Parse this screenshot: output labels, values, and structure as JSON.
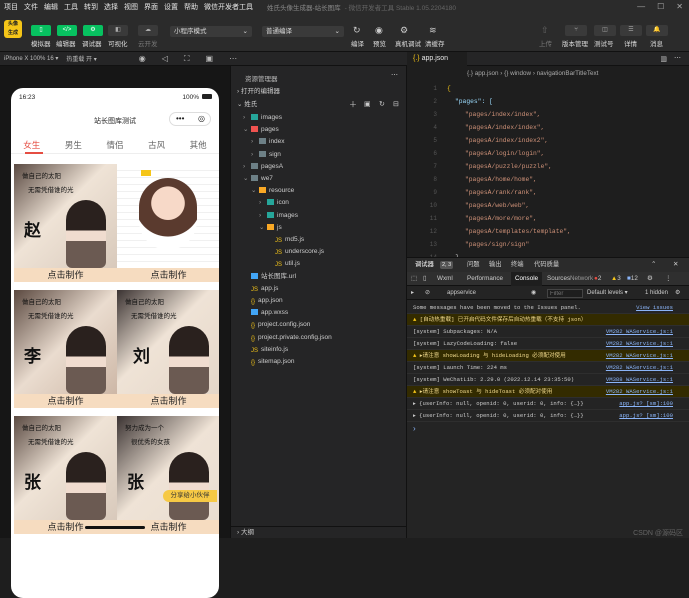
{
  "menu": [
    "项目",
    "文件",
    "编辑",
    "工具",
    "转到",
    "选择",
    "视图",
    "界面",
    "设置",
    "帮助",
    "微信开发者工具"
  ],
  "window_title": "姓氏头像生成器-站长图库",
  "window_subtitle": "- 微信开发者工具 Stable 1.05.2204180",
  "toolbar": {
    "left": [
      "模拟器",
      "编辑器",
      "调试器",
      "可视化",
      "云开发"
    ],
    "mode_select": "小程序模式",
    "compile_select": "普通编译",
    "mid": [
      "编译",
      "预览",
      "真机调试",
      "清缓存"
    ],
    "right": [
      "上传",
      "版本管理",
      "测试号",
      "详情",
      "消息"
    ]
  },
  "subbar": {
    "device": "iPhone X 100% 16 ▾",
    "hotreload": "热重载 开 ▾"
  },
  "phone": {
    "time": "16:23",
    "battery": "100%",
    "title": "站长图库测试",
    "tabs": [
      "女生",
      "男生",
      "情侣",
      "古风",
      "其他"
    ],
    "cards": [
      {
        "char": "赵",
        "line1": "做自己的太阳",
        "line2": "无需凭借谁的光",
        "caption": "点击制作"
      },
      {
        "char": "",
        "line1": "",
        "line2": "",
        "caption": "点击制作"
      },
      {
        "char": "李",
        "line1": "做自己的太阳",
        "line2": "无需凭借谁的光",
        "caption": "点击制作"
      },
      {
        "char": "刘",
        "line1": "做自己的太阳",
        "line2": "无需凭借谁的光",
        "caption": "点击制作"
      },
      {
        "char": "张",
        "line1": "做自己的太阳",
        "line2": "无需凭借谁的光",
        "caption": "点击制作"
      },
      {
        "char": "张",
        "line1": "努力成为一个",
        "line2": "很优秀的女孩",
        "caption": "点击制作"
      }
    ],
    "share": "分享给小伙伴"
  },
  "explorer": {
    "title": "资源管理器",
    "open_editors": "打开的编辑器",
    "project": "姓氏",
    "tree": [
      {
        "label": "images",
        "indent": 1,
        "kind": "folder-teal",
        "arrow": "›"
      },
      {
        "label": "pages",
        "indent": 1,
        "kind": "folder-red",
        "arrow": "⌄"
      },
      {
        "label": "index",
        "indent": 2,
        "kind": "folder",
        "arrow": "›"
      },
      {
        "label": "sign",
        "indent": 2,
        "kind": "folder",
        "arrow": "›"
      },
      {
        "label": "pagesA",
        "indent": 1,
        "kind": "folder",
        "arrow": "›"
      },
      {
        "label": "we7",
        "indent": 1,
        "kind": "folder",
        "arrow": "⌄"
      },
      {
        "label": "resource",
        "indent": 2,
        "kind": "folder-yellow",
        "arrow": "⌄"
      },
      {
        "label": "icon",
        "indent": 3,
        "kind": "folder-teal",
        "arrow": "›"
      },
      {
        "label": "images",
        "indent": 3,
        "kind": "folder-teal",
        "arrow": "›"
      },
      {
        "label": "js",
        "indent": 3,
        "kind": "folder-yellow",
        "arrow": "⌄"
      },
      {
        "label": "md5.js",
        "indent": 4,
        "kind": "js",
        "arrow": ""
      },
      {
        "label": "underscore.js",
        "indent": 4,
        "kind": "js",
        "arrow": ""
      },
      {
        "label": "util.js",
        "indent": 4,
        "kind": "js",
        "arrow": ""
      },
      {
        "label": "站长图库.url",
        "indent": 1,
        "kind": "url",
        "arrow": ""
      },
      {
        "label": "app.js",
        "indent": 1,
        "kind": "js",
        "arrow": ""
      },
      {
        "label": "app.json",
        "indent": 1,
        "kind": "json",
        "arrow": ""
      },
      {
        "label": "app.wxss",
        "indent": 1,
        "kind": "wxss",
        "arrow": ""
      },
      {
        "label": "project.config.json",
        "indent": 1,
        "kind": "json",
        "arrow": ""
      },
      {
        "label": "project.private.config.json",
        "indent": 1,
        "kind": "json",
        "arrow": ""
      },
      {
        "label": "siteinfo.js",
        "indent": 1,
        "kind": "js",
        "arrow": ""
      },
      {
        "label": "sitemap.json",
        "indent": 1,
        "kind": "json",
        "arrow": ""
      }
    ],
    "outline": "大纲"
  },
  "editor": {
    "tab": "app.json",
    "breadcrumb": "{.} app.json › {} window › navigationBarTitleText",
    "lines": [
      {
        "n": "1",
        "text": "{"
      },
      {
        "n": "2",
        "text": "\"pages\": ["
      },
      {
        "n": "3",
        "text": "\"pages/index/index\","
      },
      {
        "n": "4",
        "text": "\"pagesA/index/index\","
      },
      {
        "n": "5",
        "text": "\"pagesA/index/index2\","
      },
      {
        "n": "6",
        "text": "\"pagesA/login/login\","
      },
      {
        "n": "7",
        "text": "\"pagesA/puzzle/puzzle\","
      },
      {
        "n": "8",
        "text": "\"pagesA/home/home\","
      },
      {
        "n": "9",
        "text": "\"pagesA/rank/rank\","
      },
      {
        "n": "10",
        "text": "\"pagesA/web/web\","
      },
      {
        "n": "11",
        "text": "\"pagesA/more/more\","
      },
      {
        "n": "12",
        "text": "\"pagesA/templates/template\","
      },
      {
        "n": "13",
        "text": "\"pages/sign/sign\""
      },
      {
        "n": "14",
        "text": "],"
      }
    ]
  },
  "devtools": {
    "top_tabs": [
      "调试器",
      "2, 3",
      "问题",
      "输出",
      "终端",
      "代码质量"
    ],
    "panel_tabs": [
      "Wxml",
      "Performance",
      "Console",
      "Sources",
      "Network"
    ],
    "context": "appservice",
    "filter_placeholder": "Filter",
    "levels": "Default levels ▾",
    "hidden": "1 hidden",
    "counts": {
      "errors": "2",
      "warnings": "3",
      "info": "12"
    },
    "logs": [
      {
        "kind": "info",
        "text": "Some messages have been moved to the Issues panel.",
        "src": "View issues"
      },
      {
        "kind": "warn",
        "text": "[自动热重载] 已开启代码文件保存后自动热重载（不支持 json）",
        "src": ""
      },
      {
        "kind": "info",
        "text": "[system] Subpackages: N/A",
        "src": "VM282 WAService.js:1"
      },
      {
        "kind": "info",
        "text": "[system] LazyCodeLoading: false",
        "src": "VM282 WAService.js:1"
      },
      {
        "kind": "warn",
        "text": "▸请注意 showLoading 与 hideLoading 必须配对使用",
        "src": "VM282 WAService.js:1"
      },
      {
        "kind": "info",
        "text": "[system] Launch Time: 224 ms",
        "src": "VM282 WAService.js:1"
      },
      {
        "kind": "info",
        "text": "[system] WeChatLib: 2.29.0 (2022.12.14 23:35:50)",
        "src": "VM388 WAService.js:1"
      },
      {
        "kind": "warn",
        "text": "▸请注意 showToast 与 hideToast 必须配对使用",
        "src": "VM282 WAService.js:1"
      },
      {
        "kind": "info",
        "text": "▸ {userInfo: null, openid: 0, userid: 0, info: {…}}",
        "src": "app.js? [sm]:100"
      },
      {
        "kind": "info",
        "text": "▸ {userInfo: null, openid: 0, userid: 0, info: {…}}",
        "src": "app.js? [sm]:100"
      }
    ]
  },
  "watermark": "CSDN @源码区"
}
